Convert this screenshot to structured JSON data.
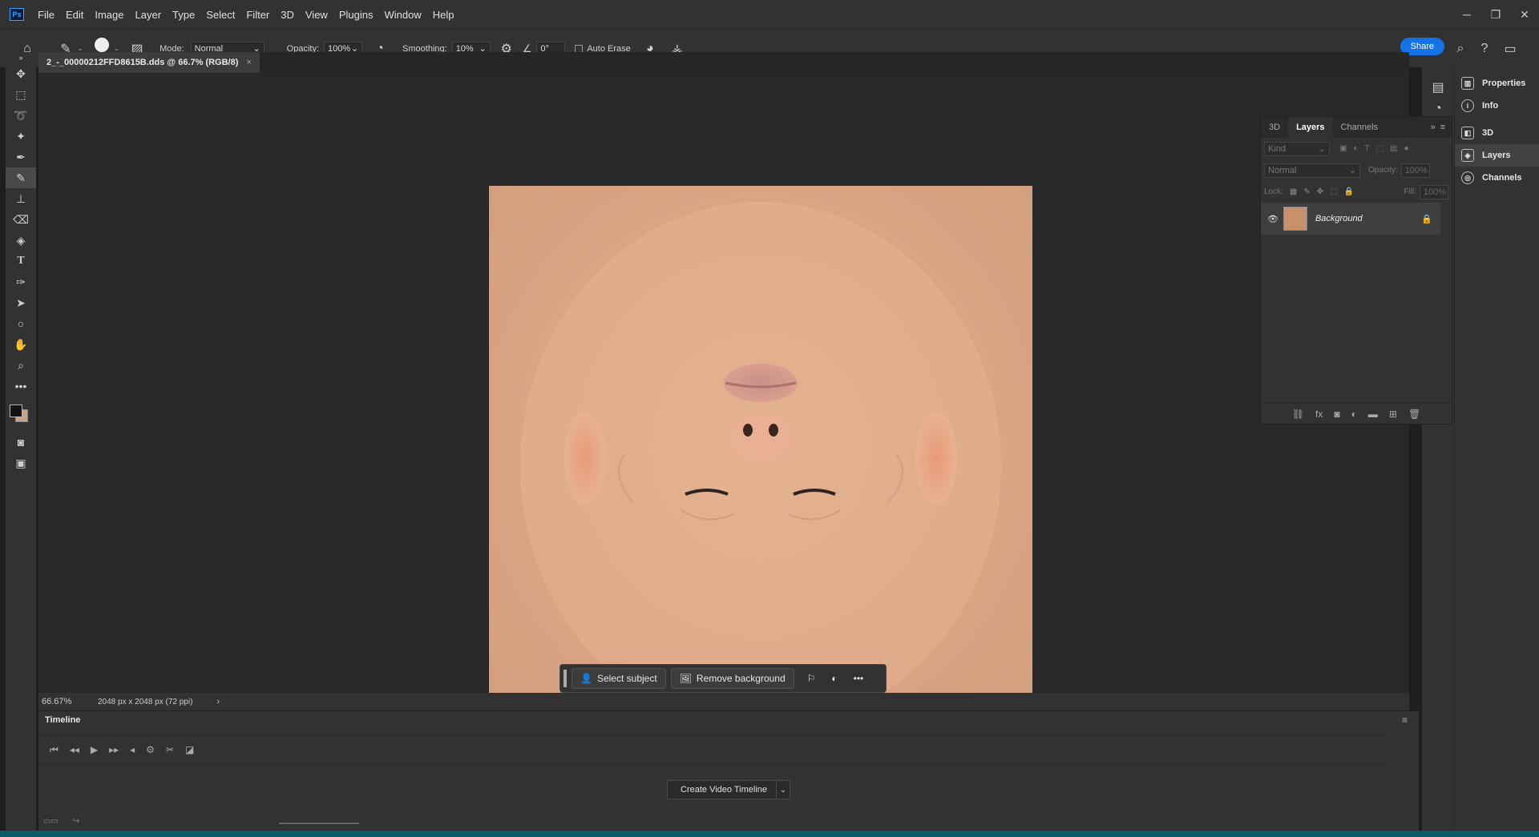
{
  "menubar": {
    "app_badge": "Ps",
    "items": [
      "File",
      "Edit",
      "Image",
      "Layer",
      "Type",
      "Select",
      "Filter",
      "3D",
      "View",
      "Plugins",
      "Window",
      "Help"
    ]
  },
  "options": {
    "brush_size": "309",
    "mode_label": "Mode:",
    "mode_value": "Normal",
    "opacity_label": "Opacity:",
    "opacity_value": "100%",
    "smoothing_label": "Smoothing:",
    "smoothing_value": "10%",
    "angle_value": "0°",
    "auto_erase_label": "Auto Erase",
    "share_label": "Share"
  },
  "document": {
    "tab_title": "2_-_00000212FFD8615B.dds @ 66.7% (RGB/8)",
    "zoom": "66.67%",
    "dimensions": "2048 px x 2048 px (72 ppi)"
  },
  "context_bar": {
    "select_subject": "Select subject",
    "remove_background": "Remove background"
  },
  "timeline": {
    "title": "Timeline",
    "create_label": "Create Video Timeline"
  },
  "layers_panel": {
    "tabs": [
      "3D",
      "Layers",
      "Channels"
    ],
    "active_tab": "Layers",
    "search_placeholder": "Kind",
    "blend_mode": "Normal",
    "opacity_label": "Opacity:",
    "opacity_value": "100%",
    "lock_label": "Lock:",
    "fill_label": "Fill:",
    "fill_value": "100%",
    "layer_name": "Background"
  },
  "right_panel": {
    "items": [
      {
        "label": "Properties",
        "icon": "properties-icon"
      },
      {
        "label": "Info",
        "icon": "info-icon"
      },
      {
        "label": "3D",
        "icon": "cube-icon"
      },
      {
        "label": "Layers",
        "icon": "layers-icon"
      },
      {
        "label": "Channels",
        "icon": "channels-icon"
      }
    ],
    "active": "Layers"
  },
  "colors": {
    "accent": "#1473e6",
    "skin": "#dba988"
  }
}
